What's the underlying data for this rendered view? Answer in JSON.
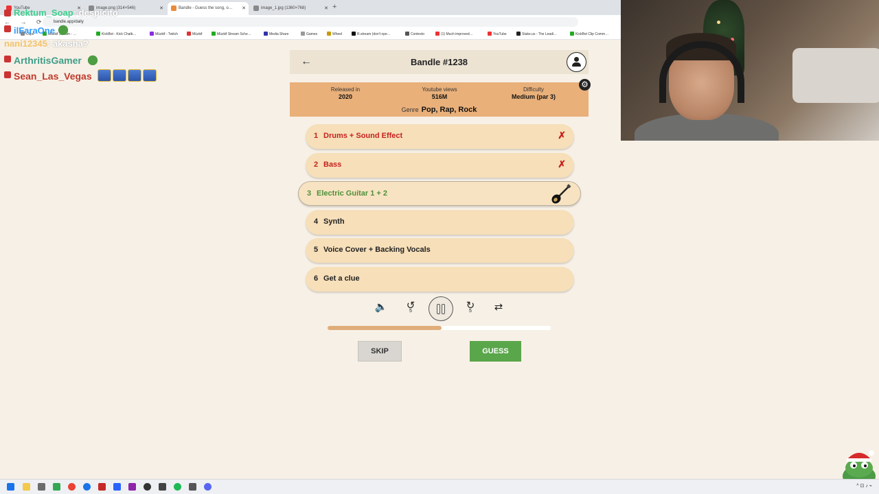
{
  "browser": {
    "tabs": [
      {
        "label": "YouTube",
        "active": false
      },
      {
        "label": "image.png (314×546)",
        "active": false
      },
      {
        "label": "Bandle - Guess the song, o…",
        "active": true
      },
      {
        "label": "image_1.jpg (1360×768)",
        "active": false
      }
    ],
    "url": "bandle.app/daily",
    "bookmarks": [
      "Clips",
      "Müzkif Stream - …",
      "KickBot - Kick Chatb…",
      "Müzkif - Twitch",
      "Müzkif",
      "Müzkif Stream Sche…",
      "Media Share",
      "Games",
      "Wheel",
      "R.stream (don't ope…",
      "Contexto",
      "(1) Much improved…",
      "YouTube",
      "Stake.us - The Leadi…",
      "KickBot Clip Comm…"
    ]
  },
  "chat": {
    "lines": [
      {
        "user": "Rektum_Soap",
        "message": ": despicito",
        "color": "#3fd08f"
      },
      {
        "user": "ilFaraOne",
        "message": "",
        "color": "#2e9cff"
      },
      {
        "user": "nani12345",
        "message": ": akasha?",
        "color": "#f3c36b"
      },
      {
        "user": "ArthritisGamer",
        "message": "",
        "color": "#3e9e88"
      },
      {
        "user": "Sean_Las_Vegas",
        "message": "",
        "color": "#c0392b"
      }
    ]
  },
  "game": {
    "title": "Bandle #1238",
    "back_label": "←",
    "info": {
      "released_label": "Released in",
      "released_value": "2020",
      "views_label": "Youtube views",
      "views_value": "516M",
      "difficulty_label": "Difficulty",
      "difficulty_value": "Medium (par 3)",
      "genre_label": "Genre",
      "genre_value": "Pop, Rap, Rock"
    },
    "stems": [
      {
        "num": "1",
        "name": "Drums + Sound Effect",
        "state": "failed",
        "mark": "✗"
      },
      {
        "num": "2",
        "name": "Bass",
        "state": "failed",
        "mark": "✗"
      },
      {
        "num": "3",
        "name": "Electric Guitar 1 + 2",
        "state": "active",
        "mark": ""
      },
      {
        "num": "4",
        "name": "Synth",
        "state": "locked",
        "mark": ""
      },
      {
        "num": "5",
        "name": "Voice Cover + Backing Vocals",
        "state": "locked",
        "mark": ""
      },
      {
        "num": "6",
        "name": "Get a clue",
        "state": "locked",
        "mark": ""
      }
    ],
    "controls": {
      "rewind_seconds": "5",
      "forward_seconds": "5"
    },
    "progress_fraction": 0.51,
    "skip_label": "SKIP",
    "guess_label": "GUESS"
  },
  "colors": {
    "background": "#f7f0e6",
    "info_panel": "#e9b07a",
    "stem_bg": "#f6dfb9",
    "failed": "#c5221f",
    "active": "#4e8f3b",
    "guess_button": "#5aa64a",
    "progress_fill": "#e0ad7a"
  },
  "icons": [
    "volume-icon",
    "rewind-5-icon",
    "pause-icon",
    "forward-5-icon",
    "repeat-icon",
    "settings-gear-icon",
    "profile-icon",
    "guitar-icon"
  ]
}
